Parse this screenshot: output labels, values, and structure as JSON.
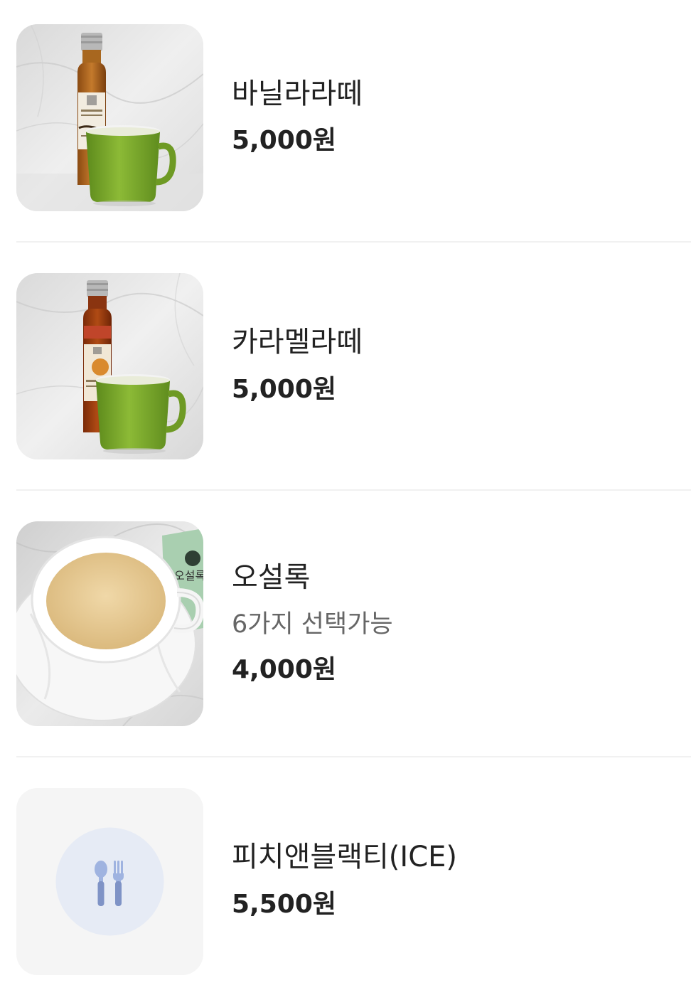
{
  "menu": {
    "items": [
      {
        "name": "바닐라라떼",
        "price": "5,000원",
        "image_icon": "vanilla-syrup-mug-photo"
      },
      {
        "name": "카라멜라떼",
        "price": "5,000원",
        "image_icon": "caramel-syrup-mug-photo"
      },
      {
        "name": "오설록",
        "description": "6가지 선택가능",
        "price": "4,000원",
        "image_icon": "tea-cup-photo"
      },
      {
        "name": "피치앤블랙티(ICE)",
        "price": "5,500원",
        "image_icon": "utensils-icon"
      }
    ]
  },
  "colors": {
    "text_primary": "#222222",
    "text_secondary": "#666666",
    "divider": "#f1f1f1",
    "placeholder_bg": "#f5f5f5",
    "placeholder_circle": "#e6ebf5",
    "utensils": "#8ea2d2",
    "mug_green": "#7aa32a"
  }
}
